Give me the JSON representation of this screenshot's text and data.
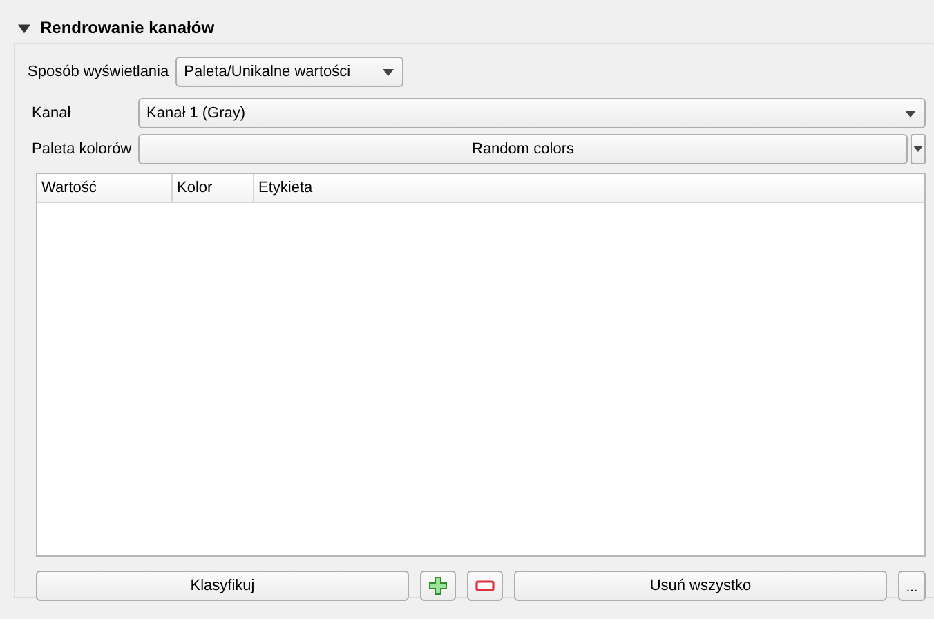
{
  "section": {
    "title": "Rendrowanie kanałów",
    "expanded": true
  },
  "render_type": {
    "label": "Sposób wyświetlania",
    "value": "Paleta/Unikalne wartości"
  },
  "band": {
    "label": "Kanał",
    "value": "Kanał 1 (Gray)"
  },
  "color_ramp": {
    "label": "Paleta kolorów",
    "value": "Random colors"
  },
  "table": {
    "columns": [
      "Wartość",
      "Kolor",
      "Etykieta"
    ]
  },
  "buttons": [
    {
      "kind": "text",
      "label": "Klasyfikuj"
    },
    {
      "kind": "add"
    },
    {
      "kind": "remove"
    },
    {
      "kind": "text",
      "label": "Usuń wszystko"
    },
    {
      "kind": "menu",
      "label": "..."
    }
  ]
}
